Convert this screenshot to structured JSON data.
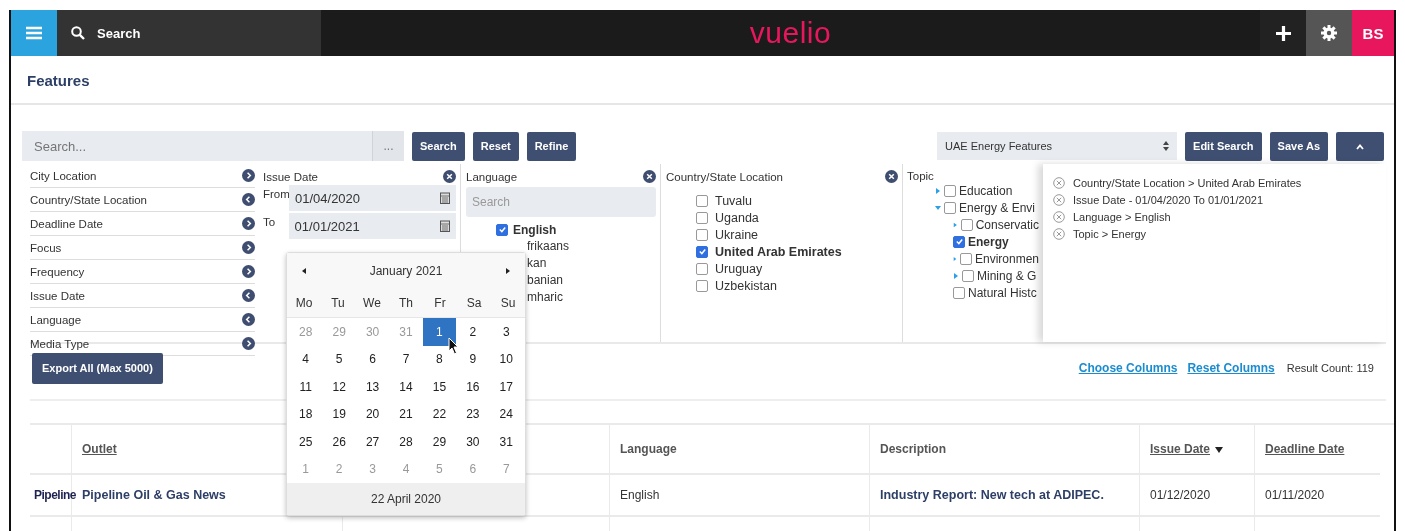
{
  "topbar": {
    "search_label": "Search",
    "logo": "vuelio",
    "avatar": "BS"
  },
  "page": {
    "title": "Features"
  },
  "searchbar": {
    "placeholder": "Search...",
    "more": "...",
    "buttons": [
      "Search",
      "Reset",
      "Refine"
    ],
    "saved_search": "UAE Energy Features",
    "right_buttons": [
      "Edit Search",
      "Save As"
    ]
  },
  "facets": [
    {
      "label": "City Location",
      "open": false
    },
    {
      "label": "Country/State Location",
      "open": true
    },
    {
      "label": "Deadline Date",
      "open": false
    },
    {
      "label": "Focus",
      "open": false
    },
    {
      "label": "Frequency",
      "open": false
    },
    {
      "label": "Issue Date",
      "open": true
    },
    {
      "label": "Language",
      "open": true
    },
    {
      "label": "Media Type",
      "open": false
    }
  ],
  "issue_date": {
    "title": "Issue Date",
    "from_label": "From",
    "from": "01/04/2020",
    "to_label": "To",
    "to": "01/01/2021"
  },
  "language": {
    "title": "Language",
    "placeholder": "Search",
    "items": [
      {
        "label": "English",
        "checked": true
      }
    ],
    "covered_items": [
      "frikaans",
      "kan",
      "banian",
      "mharic"
    ]
  },
  "country": {
    "title": "Country/State Location",
    "items": [
      {
        "label": "Tuvalu",
        "checked": false
      },
      {
        "label": "Uganda",
        "checked": false
      },
      {
        "label": "Ukraine",
        "checked": false
      },
      {
        "label": "United Arab Emirates",
        "checked": true
      },
      {
        "label": "Uruguay",
        "checked": false
      },
      {
        "label": "Uzbekistan",
        "checked": false
      }
    ]
  },
  "topic": {
    "title": "Topic",
    "items": [
      {
        "label": "Education",
        "checked": false,
        "expanded": false
      },
      {
        "label": "Energy & Envi",
        "checked": false,
        "expanded": true,
        "children": [
          {
            "label": "Conservatic",
            "checked": false,
            "expanded": false
          },
          {
            "label": "Energy",
            "checked": true
          },
          {
            "label": "Environmen",
            "checked": false,
            "expanded": false
          },
          {
            "label": "Mining & G",
            "checked": false,
            "expanded": false
          },
          {
            "label": "Natural Histc",
            "checked": false
          }
        ]
      }
    ]
  },
  "criteria": [
    "Country/State Location > United Arab Emirates",
    "Issue Date - 01/04/2020 To 01/01/2021",
    "Language > English",
    "Topic > Energy"
  ],
  "export_button": "Export All (Max 5000)",
  "links": [
    "Choose Columns",
    "Reset Columns"
  ],
  "result_count": "Result Count: 119",
  "calendar": {
    "month": "January 2021",
    "weekdays": [
      "Mo",
      "Tu",
      "We",
      "Th",
      "Fr",
      "Sa",
      "Su"
    ],
    "today": "22 April 2020",
    "days": [
      {
        "day": "28",
        "outside": true,
        "selected": false
      },
      {
        "day": "29",
        "outside": true,
        "selected": false
      },
      {
        "day": "30",
        "outside": true,
        "selected": false
      },
      {
        "day": "31",
        "outside": true,
        "selected": false
      },
      {
        "day": "1",
        "outside": false,
        "selected": true
      },
      {
        "day": "2",
        "outside": false,
        "selected": false
      },
      {
        "day": "3",
        "outside": false,
        "selected": false
      },
      {
        "day": "4",
        "outside": false,
        "selected": false
      },
      {
        "day": "5",
        "outside": false,
        "selected": false
      },
      {
        "day": "6",
        "outside": false,
        "selected": false
      },
      {
        "day": "7",
        "outside": false,
        "selected": false
      },
      {
        "day": "8",
        "outside": false,
        "selected": false
      },
      {
        "day": "9",
        "outside": false,
        "selected": false
      },
      {
        "day": "10",
        "outside": false,
        "selected": false
      },
      {
        "day": "11",
        "outside": false,
        "selected": false
      },
      {
        "day": "12",
        "outside": false,
        "selected": false
      },
      {
        "day": "13",
        "outside": false,
        "selected": false
      },
      {
        "day": "14",
        "outside": false,
        "selected": false
      },
      {
        "day": "15",
        "outside": false,
        "selected": false
      },
      {
        "day": "16",
        "outside": false,
        "selected": false
      },
      {
        "day": "17",
        "outside": false,
        "selected": false
      },
      {
        "day": "18",
        "outside": false,
        "selected": false
      },
      {
        "day": "19",
        "outside": false,
        "selected": false
      },
      {
        "day": "20",
        "outside": false,
        "selected": false
      },
      {
        "day": "21",
        "outside": false,
        "selected": false
      },
      {
        "day": "22",
        "outside": false,
        "selected": false
      },
      {
        "day": "23",
        "outside": false,
        "selected": false
      },
      {
        "day": "24",
        "outside": false,
        "selected": false
      },
      {
        "day": "25",
        "outside": false,
        "selected": false
      },
      {
        "day": "26",
        "outside": false,
        "selected": false
      },
      {
        "day": "27",
        "outside": false,
        "selected": false
      },
      {
        "day": "28",
        "outside": false,
        "selected": false
      },
      {
        "day": "29",
        "outside": false,
        "selected": false
      },
      {
        "day": "30",
        "outside": false,
        "selected": false
      },
      {
        "day": "31",
        "outside": false,
        "selected": false
      },
      {
        "day": "1",
        "outside": true,
        "selected": false
      },
      {
        "day": "2",
        "outside": true,
        "selected": false
      },
      {
        "day": "3",
        "outside": true,
        "selected": false
      },
      {
        "day": "4",
        "outside": true,
        "selected": false
      },
      {
        "day": "5",
        "outside": true,
        "selected": false
      },
      {
        "day": "6",
        "outside": true,
        "selected": false
      },
      {
        "day": "7",
        "outside": true,
        "selected": false
      }
    ]
  },
  "table": {
    "columns": [
      {
        "label": "Outlet",
        "sortable": true,
        "sorted": false
      },
      {
        "label": "Language",
        "sortable": false,
        "sorted": false
      },
      {
        "label": "Description",
        "sortable": false,
        "sorted": false
      },
      {
        "label": "Issue Date",
        "sortable": true,
        "sorted": true
      },
      {
        "label": "Deadline Date",
        "sortable": true,
        "sorted": false
      }
    ],
    "rows": [
      {
        "logo": "Pipeline",
        "outlet": "Pipeline Oil & Gas News",
        "language": "English",
        "description": "Industry Report: New tech at ADIPEC.",
        "issue_date": "01/12/2020",
        "deadline_date": "01/11/2020"
      }
    ]
  }
}
